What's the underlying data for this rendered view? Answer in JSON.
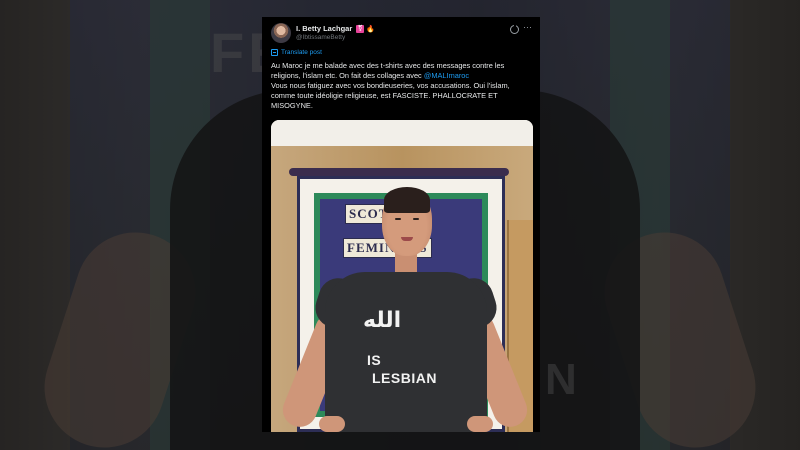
{
  "post": {
    "display_name": "I. Betty Lachgar",
    "emojis": [
      "⚧",
      "🔥"
    ],
    "handle": "@IbtissameBetty",
    "translate_label": "Translate post",
    "text_part1": "Au Maroc je me balade avec des t-shirts avec des messages contre les religions, l’islam etc. On fait des collages avec ",
    "mention": "@MALImaroc",
    "text_part2": "Vous nous fatiguez avec vos bondieuseries, vos accusations. Oui l’islam, comme toute idéoligie religieuse, est FASCISTE. PHALLOCRATE ET MISOGYNE.",
    "icons": [
      "grok-icon",
      "more-icon",
      "translate-icon",
      "avatar"
    ]
  },
  "photo": {
    "banner_word1": "SCOTTISH",
    "banner_word2": "FEMINISTS",
    "shirt_arabic": "الله",
    "shirt_line1": "IS",
    "shirt_line2": "LESBIAN"
  },
  "backdrop": {
    "text_left": "FE",
    "text_right": "N"
  },
  "colors": {
    "link": "#1d9bf0",
    "text": "#e7e9ea",
    "muted": "#71767b",
    "card_bg": "#000000"
  }
}
